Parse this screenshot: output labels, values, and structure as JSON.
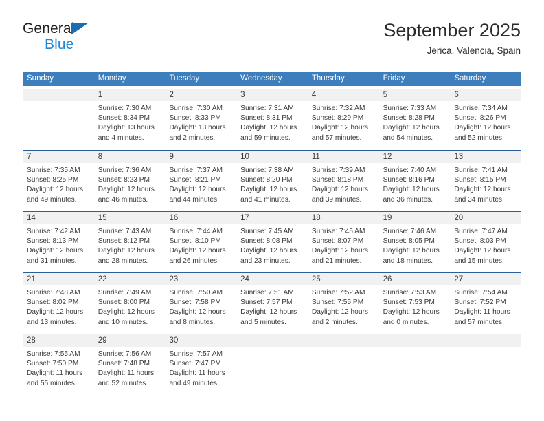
{
  "brand": {
    "line1": "General",
    "line2": "Blue",
    "triangle_color": "#1b6cb3",
    "blue_text_color": "#1e87d6"
  },
  "header": {
    "title": "September 2025",
    "subtitle": "Jerica, Valencia, Spain"
  },
  "theme": {
    "header_bg": "#3d7ebc",
    "row_rule": "#2a6099",
    "day_band_bg": "#f1f1f1",
    "text": "#3a3a3a"
  },
  "weekdays": [
    "Sunday",
    "Monday",
    "Tuesday",
    "Wednesday",
    "Thursday",
    "Friday",
    "Saturday"
  ],
  "weeks": [
    [
      {
        "day": "",
        "lines": []
      },
      {
        "day": "1",
        "lines": [
          "Sunrise: 7:30 AM",
          "Sunset: 8:34 PM",
          "Daylight: 13 hours",
          "and 4 minutes."
        ]
      },
      {
        "day": "2",
        "lines": [
          "Sunrise: 7:30 AM",
          "Sunset: 8:33 PM",
          "Daylight: 13 hours",
          "and 2 minutes."
        ]
      },
      {
        "day": "3",
        "lines": [
          "Sunrise: 7:31 AM",
          "Sunset: 8:31 PM",
          "Daylight: 12 hours",
          "and 59 minutes."
        ]
      },
      {
        "day": "4",
        "lines": [
          "Sunrise: 7:32 AM",
          "Sunset: 8:29 PM",
          "Daylight: 12 hours",
          "and 57 minutes."
        ]
      },
      {
        "day": "5",
        "lines": [
          "Sunrise: 7:33 AM",
          "Sunset: 8:28 PM",
          "Daylight: 12 hours",
          "and 54 minutes."
        ]
      },
      {
        "day": "6",
        "lines": [
          "Sunrise: 7:34 AM",
          "Sunset: 8:26 PM",
          "Daylight: 12 hours",
          "and 52 minutes."
        ]
      }
    ],
    [
      {
        "day": "7",
        "lines": [
          "Sunrise: 7:35 AM",
          "Sunset: 8:25 PM",
          "Daylight: 12 hours",
          "and 49 minutes."
        ]
      },
      {
        "day": "8",
        "lines": [
          "Sunrise: 7:36 AM",
          "Sunset: 8:23 PM",
          "Daylight: 12 hours",
          "and 46 minutes."
        ]
      },
      {
        "day": "9",
        "lines": [
          "Sunrise: 7:37 AM",
          "Sunset: 8:21 PM",
          "Daylight: 12 hours",
          "and 44 minutes."
        ]
      },
      {
        "day": "10",
        "lines": [
          "Sunrise: 7:38 AM",
          "Sunset: 8:20 PM",
          "Daylight: 12 hours",
          "and 41 minutes."
        ]
      },
      {
        "day": "11",
        "lines": [
          "Sunrise: 7:39 AM",
          "Sunset: 8:18 PM",
          "Daylight: 12 hours",
          "and 39 minutes."
        ]
      },
      {
        "day": "12",
        "lines": [
          "Sunrise: 7:40 AM",
          "Sunset: 8:16 PM",
          "Daylight: 12 hours",
          "and 36 minutes."
        ]
      },
      {
        "day": "13",
        "lines": [
          "Sunrise: 7:41 AM",
          "Sunset: 8:15 PM",
          "Daylight: 12 hours",
          "and 34 minutes."
        ]
      }
    ],
    [
      {
        "day": "14",
        "lines": [
          "Sunrise: 7:42 AM",
          "Sunset: 8:13 PM",
          "Daylight: 12 hours",
          "and 31 minutes."
        ]
      },
      {
        "day": "15",
        "lines": [
          "Sunrise: 7:43 AM",
          "Sunset: 8:12 PM",
          "Daylight: 12 hours",
          "and 28 minutes."
        ]
      },
      {
        "day": "16",
        "lines": [
          "Sunrise: 7:44 AM",
          "Sunset: 8:10 PM",
          "Daylight: 12 hours",
          "and 26 minutes."
        ]
      },
      {
        "day": "17",
        "lines": [
          "Sunrise: 7:45 AM",
          "Sunset: 8:08 PM",
          "Daylight: 12 hours",
          "and 23 minutes."
        ]
      },
      {
        "day": "18",
        "lines": [
          "Sunrise: 7:45 AM",
          "Sunset: 8:07 PM",
          "Daylight: 12 hours",
          "and 21 minutes."
        ]
      },
      {
        "day": "19",
        "lines": [
          "Sunrise: 7:46 AM",
          "Sunset: 8:05 PM",
          "Daylight: 12 hours",
          "and 18 minutes."
        ]
      },
      {
        "day": "20",
        "lines": [
          "Sunrise: 7:47 AM",
          "Sunset: 8:03 PM",
          "Daylight: 12 hours",
          "and 15 minutes."
        ]
      }
    ],
    [
      {
        "day": "21",
        "lines": [
          "Sunrise: 7:48 AM",
          "Sunset: 8:02 PM",
          "Daylight: 12 hours",
          "and 13 minutes."
        ]
      },
      {
        "day": "22",
        "lines": [
          "Sunrise: 7:49 AM",
          "Sunset: 8:00 PM",
          "Daylight: 12 hours",
          "and 10 minutes."
        ]
      },
      {
        "day": "23",
        "lines": [
          "Sunrise: 7:50 AM",
          "Sunset: 7:58 PM",
          "Daylight: 12 hours",
          "and 8 minutes."
        ]
      },
      {
        "day": "24",
        "lines": [
          "Sunrise: 7:51 AM",
          "Sunset: 7:57 PM",
          "Daylight: 12 hours",
          "and 5 minutes."
        ]
      },
      {
        "day": "25",
        "lines": [
          "Sunrise: 7:52 AM",
          "Sunset: 7:55 PM",
          "Daylight: 12 hours",
          "and 2 minutes."
        ]
      },
      {
        "day": "26",
        "lines": [
          "Sunrise: 7:53 AM",
          "Sunset: 7:53 PM",
          "Daylight: 12 hours",
          "and 0 minutes."
        ]
      },
      {
        "day": "27",
        "lines": [
          "Sunrise: 7:54 AM",
          "Sunset: 7:52 PM",
          "Daylight: 11 hours",
          "and 57 minutes."
        ]
      }
    ],
    [
      {
        "day": "28",
        "lines": [
          "Sunrise: 7:55 AM",
          "Sunset: 7:50 PM",
          "Daylight: 11 hours",
          "and 55 minutes."
        ]
      },
      {
        "day": "29",
        "lines": [
          "Sunrise: 7:56 AM",
          "Sunset: 7:48 PM",
          "Daylight: 11 hours",
          "and 52 minutes."
        ]
      },
      {
        "day": "30",
        "lines": [
          "Sunrise: 7:57 AM",
          "Sunset: 7:47 PM",
          "Daylight: 11 hours",
          "and 49 minutes."
        ]
      },
      {
        "day": "",
        "lines": []
      },
      {
        "day": "",
        "lines": []
      },
      {
        "day": "",
        "lines": []
      },
      {
        "day": "",
        "lines": []
      }
    ]
  ]
}
